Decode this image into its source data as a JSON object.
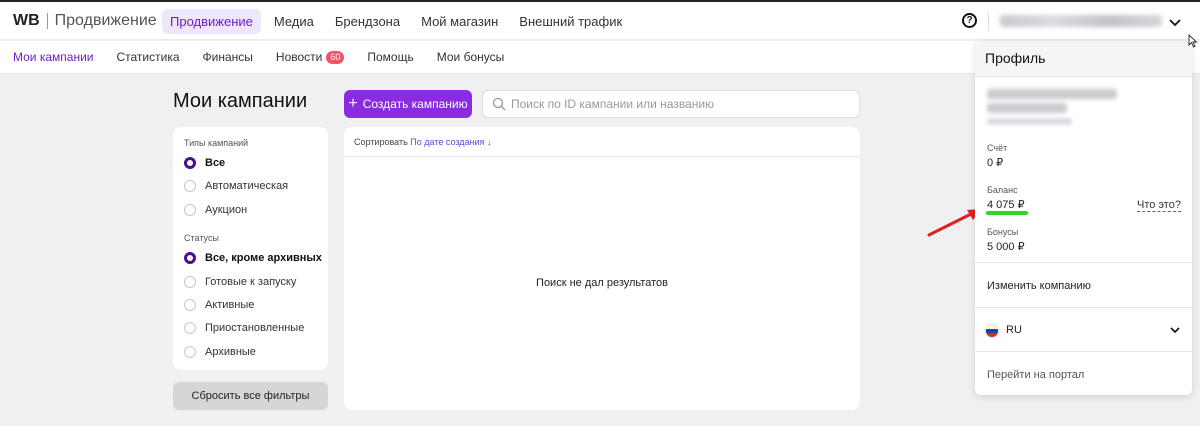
{
  "header": {
    "logo_brand": "WB",
    "logo_title": "Продвижение",
    "nav": [
      {
        "label": "Продвижение",
        "active": true
      },
      {
        "label": "Медиа",
        "active": false
      },
      {
        "label": "Брендзона",
        "active": false
      },
      {
        "label": "Мой магазин",
        "active": false
      },
      {
        "label": "Внешний трафик",
        "active": false
      }
    ],
    "help_icon": "question-circle-icon",
    "help_glyph": "?"
  },
  "subnav": {
    "items": [
      {
        "label": "Мои кампании",
        "active": true
      },
      {
        "label": "Статистика",
        "active": false
      },
      {
        "label": "Финансы",
        "active": false
      },
      {
        "label": "Новости",
        "active": false,
        "badge": "60"
      },
      {
        "label": "Помощь",
        "active": false
      },
      {
        "label": "Мои бонусы",
        "active": false
      }
    ]
  },
  "main": {
    "page_title": "Мои кампании",
    "create_button": "Создать кампанию",
    "create_icon": "+",
    "search_placeholder": "Поиск по ID кампании или названию"
  },
  "filters": {
    "campaign_types_label": "Типы кампаний",
    "campaign_types": [
      {
        "label": "Все",
        "checked": true
      },
      {
        "label": "Автоматическая",
        "checked": false
      },
      {
        "label": "Аукцион",
        "checked": false
      }
    ],
    "statuses_label": "Статусы",
    "statuses": [
      {
        "label": "Все, кроме архивных",
        "checked": true
      },
      {
        "label": "Готовые к запуску",
        "checked": false
      },
      {
        "label": "Активные",
        "checked": false
      },
      {
        "label": "Приостановленные",
        "checked": false
      },
      {
        "label": "Архивные",
        "checked": false
      }
    ],
    "reset_button": "Сбросить все фильтры"
  },
  "results": {
    "sort_label": "Сортировать",
    "sort_value": "По дате создания",
    "sort_arrow": "↓",
    "empty_text": "Поиск не дал результатов"
  },
  "profile": {
    "title": "Профиль",
    "account_label": "Счёт",
    "account_value": "0 ₽",
    "balance_label": "Баланс",
    "balance_value": "4 075 ₽",
    "what_link": "Что это?",
    "bonuses_label": "Бонусы",
    "bonuses_value": "5 000 ₽",
    "change_company": "Изменить компанию",
    "language": "RU",
    "portal_link": "Перейти на портал"
  },
  "colors": {
    "accent": "#8a2be2",
    "annotation_arrow": "#e02020",
    "annotation_underline": "#2bd52b"
  }
}
